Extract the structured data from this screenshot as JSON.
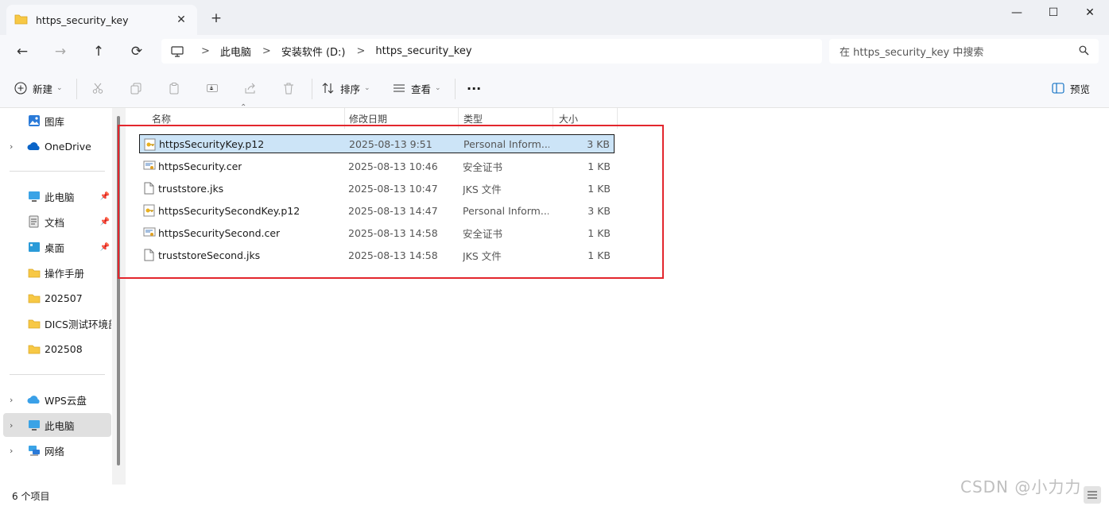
{
  "tab": {
    "title": "https_security_key",
    "close": "✕",
    "new_tab": "+"
  },
  "window_controls": {
    "minimize": "—",
    "maximize": "☐",
    "close": "✕"
  },
  "nav": {
    "back": "←",
    "forward": "→",
    "up": "↑",
    "refresh": "⟳"
  },
  "breadcrumb": [
    "此电脑",
    "安装软件 (D:)",
    "https_security_key"
  ],
  "breadcrumb_sep": ">",
  "search": {
    "placeholder": "在 https_security_key 中搜索"
  },
  "toolbar": {
    "new_label": "新建",
    "sort_label": "排序",
    "view_label": "查看",
    "more_label": "···",
    "preview_label": "预览"
  },
  "sidebar": {
    "items": [
      {
        "label": "图库",
        "icon": "gallery-icon"
      },
      {
        "label": "OneDrive",
        "icon": "onedrive-icon"
      },
      {
        "label": "此电脑",
        "icon": "computer-icon"
      },
      {
        "label": "文档",
        "icon": "document-icon"
      },
      {
        "label": "桌面",
        "icon": "desktop-icon"
      },
      {
        "label": "操作手册",
        "icon": "folder-icon"
      },
      {
        "label": "202507",
        "icon": "folder-icon"
      },
      {
        "label": "DICS测试环境部",
        "icon": "folder-icon"
      },
      {
        "label": "202508",
        "icon": "folder-icon"
      },
      {
        "label": "WPS云盘",
        "icon": "wps-cloud-icon"
      },
      {
        "label": "此电脑",
        "icon": "computer-icon"
      },
      {
        "label": "网络",
        "icon": "network-icon"
      }
    ]
  },
  "columns": {
    "name": "名称",
    "date": "修改日期",
    "type": "类型",
    "size": "大小"
  },
  "files": [
    {
      "name": "httpsSecurityKey.p12",
      "date": "2025-08-13 9:51",
      "type": "Personal Inform...",
      "size": "3 KB",
      "icon": "p12-key-icon",
      "selected": true
    },
    {
      "name": "httpsSecurity.cer",
      "date": "2025-08-13 10:46",
      "type": "安全证书",
      "size": "1 KB",
      "icon": "certificate-icon",
      "selected": false
    },
    {
      "name": "truststore.jks",
      "date": "2025-08-13 10:47",
      "type": "JKS 文件",
      "size": "1 KB",
      "icon": "file-icon",
      "selected": false
    },
    {
      "name": "httpsSecuritySecondKey.p12",
      "date": "2025-08-13 14:47",
      "type": "Personal Inform...",
      "size": "3 KB",
      "icon": "p12-key-icon",
      "selected": false
    },
    {
      "name": "httpsSecuritySecond.cer",
      "date": "2025-08-13 14:58",
      "type": "安全证书",
      "size": "1 KB",
      "icon": "certificate-icon",
      "selected": false
    },
    {
      "name": "truststoreSecond.jks",
      "date": "2025-08-13 14:58",
      "type": "JKS 文件",
      "size": "1 KB",
      "icon": "file-icon",
      "selected": false
    }
  ],
  "status": {
    "count": "6 个项目"
  },
  "watermark": "CSDN @小力力",
  "colors": {
    "accent": "#0067c0",
    "selection": "#cce4f7",
    "highlight_box": "#e3262d",
    "folder": "#f7c845"
  }
}
